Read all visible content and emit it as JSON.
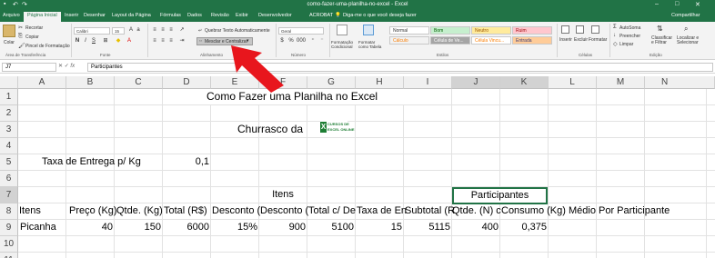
{
  "window": {
    "title": "como-fazer-uma-planilha-no-excel - Excel",
    "qa_icons": [
      "save-icon",
      "undo-icon",
      "redo-icon"
    ]
  },
  "tabs": [
    "Arquivo",
    "Página Inicial",
    "Inserir",
    "Desenhar",
    "Layout da Página",
    "Fórmulas",
    "Dados",
    "Revisão",
    "Exibir",
    "Desenvolvedor",
    "ACROBAT"
  ],
  "tell_me": "Diga-me o que você deseja fazer",
  "share": "Compartilhar",
  "ribbon": {
    "clipboard": {
      "paste": "Colar",
      "cut": "Recortar",
      "copy": "Copiar",
      "format_painter": "Pincel de Formatação",
      "group": "Área de Transferência"
    },
    "font": {
      "name": "Calibri",
      "size": "15",
      "group": "Fonte"
    },
    "alignment": {
      "wrap": "Quebrar Texto Automaticamente",
      "merge": "Mesclar e Centralizar",
      "group": "Alinhamento"
    },
    "number": {
      "format": "Geral",
      "group": "Número"
    },
    "styles": {
      "conditional": "Formatação Condicional",
      "table": "Formatar como Tabela",
      "normal": "Normal",
      "bom": "Bom",
      "neutro": "Neutro",
      "ruim": "Ruim",
      "calculo": "Cálculo",
      "celula_ve": "Célula de Ve...",
      "celula_vi": "Célula Vincu...",
      "entrada": "Entrada",
      "group": "Estilos"
    },
    "cells": {
      "insert": "Inserir",
      "delete": "Excluir",
      "format": "Formatar",
      "group": "Células"
    },
    "editing": {
      "autosum": "AutoSoma",
      "fill": "Preencher",
      "clear": "Limpar",
      "sort": "Classificar e Filtrar",
      "find": "Localizar e Selecionar",
      "group": "Edição"
    }
  },
  "formula_bar": {
    "name_box": "J7",
    "fx": "fx",
    "content": "Participantes"
  },
  "columns": [
    "A",
    "B",
    "C",
    "D",
    "E",
    "F",
    "G",
    "H",
    "I",
    "J",
    "K",
    "L",
    "M",
    "N"
  ],
  "rows": [
    "1",
    "2",
    "3",
    "4",
    "5",
    "6",
    "7",
    "8",
    "9",
    "10",
    "11"
  ],
  "cells": {
    "e1": "Como Fazer uma Planilha no Excel",
    "f3": "Churrasco da",
    "logo1": "CURSOS DE",
    "logo2": "EXCEL ONLINE",
    "a5": "Taxa de Entrega p/ Kg",
    "d5": "0,1",
    "e7": "Itens",
    "j7": "Participantes",
    "row8": [
      "Itens",
      "Preço (Kg)",
      "Qtde. (Kg)",
      "Total (R$)",
      "Desconto (",
      "Desconto (",
      "Total c/ De",
      "Taxa de En",
      "Subtotal (R",
      "Qtde. (N) c",
      "Consumo (Kg) Médio Por Participante"
    ],
    "row9": [
      "Picanha",
      "40",
      "150",
      "6000",
      "15%",
      "900",
      "5100",
      "15",
      "5115",
      "400",
      "0,375"
    ]
  },
  "colors": {
    "excel_green": "#217346",
    "arrow_red": "#e8161d",
    "selected_border": "#217346"
  }
}
